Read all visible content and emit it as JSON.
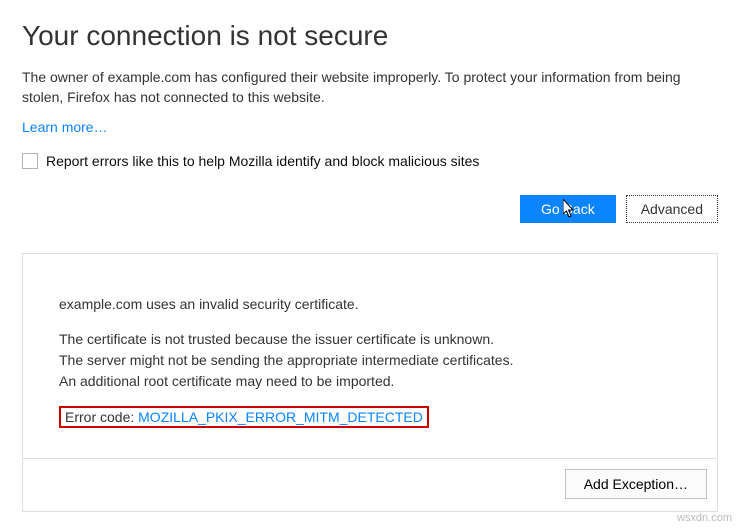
{
  "title": "Your connection is not secure",
  "description": "The owner of example.com has configured their website improperly. To protect your information from being stolen, Firefox has not connected to this website.",
  "learn_more": "Learn more…",
  "report_label": "Report errors like this to help Mozilla identify and block malicious sites",
  "buttons": {
    "go_back": "Go Back",
    "advanced": "Advanced",
    "add_exception": "Add Exception…"
  },
  "details": {
    "line1": "example.com uses an invalid security certificate.",
    "line2": "The certificate is not trusted because the issuer certificate is unknown.",
    "line3": "The server might not be sending the appropriate intermediate certificates.",
    "line4": "An additional root certificate may need to be imported.",
    "error_label": "Error code: ",
    "error_code": "MOZILLA_PKIX_ERROR_MITM_DETECTED"
  },
  "watermark": "wsxdn.com"
}
